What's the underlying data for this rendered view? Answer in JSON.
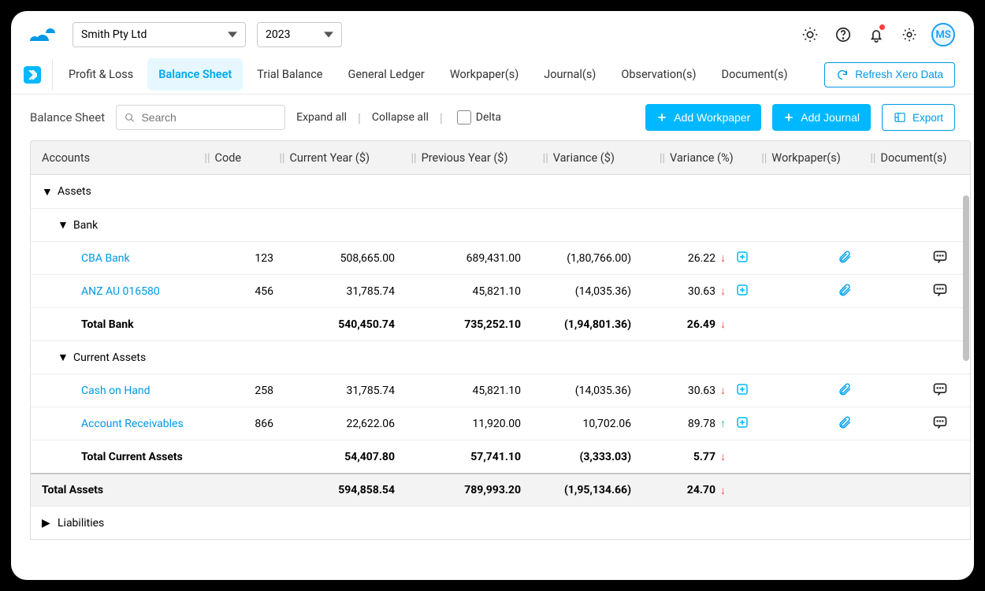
{
  "header": {
    "company": "Smith Pty Ltd",
    "year": "2023",
    "avatar": "MS"
  },
  "tabs": {
    "pl": "Profit & Loss",
    "bs": "Balance Sheet",
    "tb": "Trial Balance",
    "gl": "General Ledger",
    "wp": "Workpaper(s)",
    "jr": "Journal(s)",
    "ob": "Observation(s)",
    "doc": "Document(s)",
    "refresh": "Refresh Xero Data"
  },
  "toolbar": {
    "title": "Balance Sheet",
    "search_ph": "Search",
    "expand": "Expand all",
    "collapse": "Collapse all",
    "delta": "Delta",
    "add_wp": "Add Workpaper",
    "add_jr": "Add Journal",
    "export": "Export"
  },
  "columns": {
    "accounts": "Accounts",
    "code": "Code",
    "cy": "Current Year ($)",
    "py": "Previous Year ($)",
    "va": "Variance ($)",
    "vp": "Variance (%)",
    "wp": "Workpaper(s)",
    "doc": "Document(s)"
  },
  "rows": {
    "assets": "Assets",
    "bank": "Bank",
    "cba": {
      "name": "CBA Bank",
      "code": "123",
      "cy": "508,665.00",
      "py": "689,431.00",
      "va": "(1,80,766.00)",
      "vp": "26.22"
    },
    "anz": {
      "name": "ANZ AU 016580",
      "code": "456",
      "cy": "31,785.74",
      "py": "45,821.10",
      "va": "(14,035.36)",
      "vp": "30.63"
    },
    "tbnk": {
      "name": "Total Bank",
      "cy": "540,450.74",
      "py": "735,252.10",
      "va": "(1,94,801.36)",
      "vp": "26.49"
    },
    "cassets": "Current Assets",
    "cash": {
      "name": "Cash on Hand",
      "code": "258",
      "cy": "31,785.74",
      "py": "45,821.10",
      "va": "(14,035.36)",
      "vp": "30.63"
    },
    "ar": {
      "name": "Account Receivables",
      "code": "866",
      "cy": "22,622.06",
      "py": "11,920.00",
      "va": "10,702.06",
      "vp": "89.78"
    },
    "tca": {
      "name": "Total Current Assets",
      "cy": "54,407.80",
      "py": "57,741.10",
      "va": "(3,333.03)",
      "vp": "5.77"
    },
    "tassets": {
      "name": "Total Assets",
      "cy": "594,858.54",
      "py": "789,993.20",
      "va": "(1,95,134.66)",
      "vp": "24.70"
    },
    "liab": "Liabilities"
  }
}
